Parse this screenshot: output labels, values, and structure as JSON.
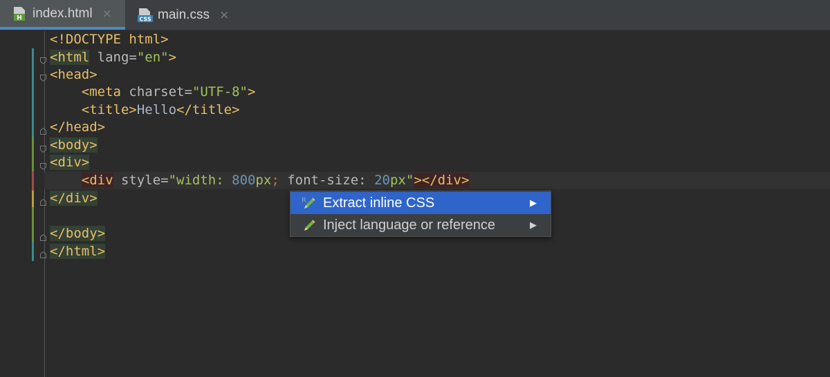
{
  "tabs": [
    {
      "label": "index.html",
      "icon": "html-file-icon",
      "icon_letter": "H",
      "active": true
    },
    {
      "label": "main.css",
      "icon": "css-file-icon",
      "icon_letter": "CSS",
      "active": false
    }
  ],
  "close_glyph": "×",
  "code": {
    "l1_tag": "<!DOCTYPE html>",
    "l2_open": "<html",
    "l2_attr": " lang=",
    "l2_val": "\"en\"",
    "l2_close": ">",
    "l3": "<head>",
    "l4_open": "<meta",
    "l4_attr": " charset=",
    "l4_val": "\"UTF-8\"",
    "l4_close": ">",
    "l5_open": "<title>",
    "l5_text": "Hello",
    "l5_close": "</title>",
    "l6": "</head>",
    "l7": "<body>",
    "l8": "<div>",
    "l9_open": "<div",
    "l9_attr": " style=",
    "l9_q1": "\"width: ",
    "l9_n1": "800",
    "l9_u1": "px",
    "l9_semi": ";",
    "l9_prop": " font-size: ",
    "l9_n2": "20",
    "l9_u2": "px",
    "l9_q2": "\"",
    "l9_close": "></div>",
    "l10": "</div>",
    "l12": "</body>",
    "l13": "</html>"
  },
  "context_menu": {
    "items": [
      {
        "label": "Extract inline CSS",
        "icon": "pencil-icon",
        "selected": true
      },
      {
        "label": "Inject language or reference",
        "icon": "pencil-icon",
        "selected": false
      }
    ],
    "arrow_glyph": "▶"
  },
  "colors": {
    "background": "#2b2b2b",
    "tag": "#e8bf6a",
    "string": "#a5c25c",
    "number": "#6897bb",
    "menu_selected": "#2f65ca"
  }
}
